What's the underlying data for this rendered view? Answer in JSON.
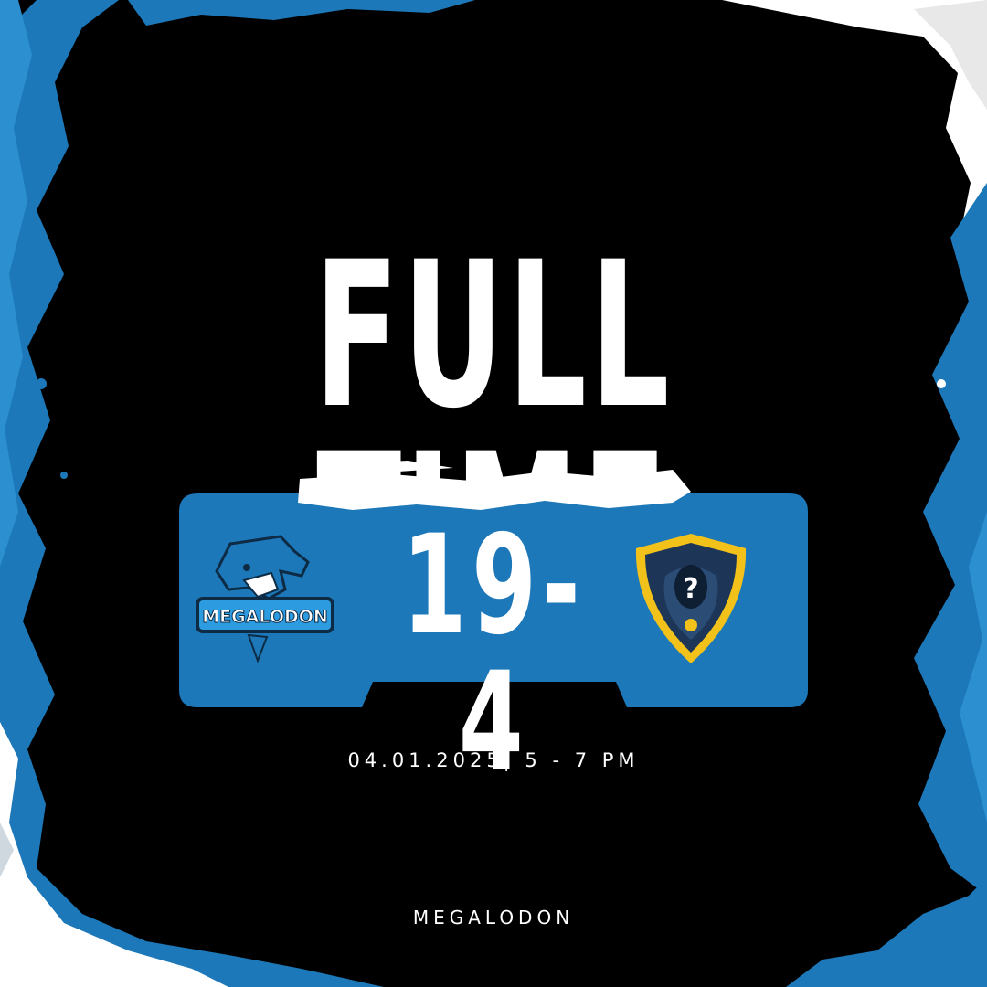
{
  "headline": "FULL TIME",
  "score": "19-4",
  "match_meta": "04.01.2025| 5 - 7 PM",
  "footer": "MEGALODON",
  "home_team": {
    "logo_text": "MEGALODON",
    "icon": "shark-mascot-icon"
  },
  "away_team": {
    "logo_text": "?",
    "icon": "mystery-shield-icon"
  },
  "colors": {
    "background": "#000000",
    "accent_blue": "#1c78b8",
    "text": "#ffffff",
    "shield_gold": "#f2c21a",
    "shield_navy": "#1d3556"
  }
}
